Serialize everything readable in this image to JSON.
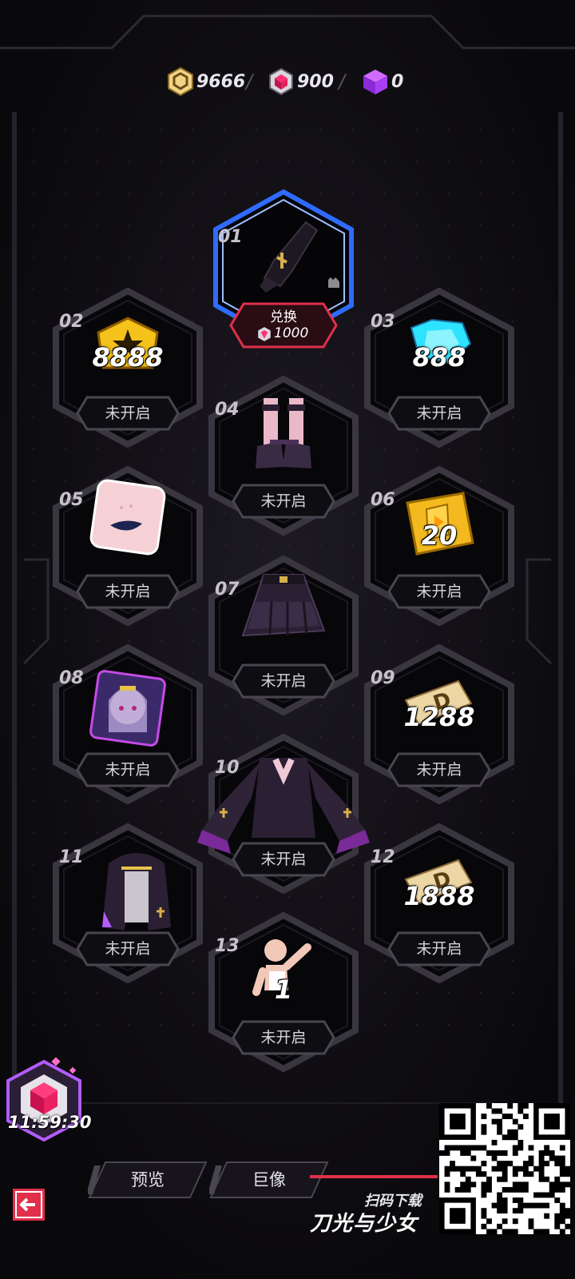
{
  "currencies": [
    {
      "icon": "gold-coin-icon",
      "value": "9666"
    },
    {
      "icon": "red-crystal-icon",
      "value": "900"
    },
    {
      "icon": "purple-cube-icon",
      "value": "0"
    }
  ],
  "featured": {
    "number": "01",
    "item_icon": "black-glove-icon",
    "exchange_label": "兑换",
    "price": "1000"
  },
  "nodes": [
    {
      "number": "02",
      "reward": "8888",
      "icon": "gold-badge-icon",
      "status": "未开启"
    },
    {
      "number": "03",
      "reward": "888",
      "icon": "blue-diamond-icon",
      "status": "未开启"
    },
    {
      "number": "04",
      "reward": "",
      "icon": "boots-outfit-icon",
      "status": "未开启"
    },
    {
      "number": "05",
      "reward": "",
      "icon": "lips-makeup-icon",
      "status": "未开启"
    },
    {
      "number": "06",
      "reward": "20",
      "icon": "gold-ticket-icon",
      "status": "未开启"
    },
    {
      "number": "07",
      "reward": "",
      "icon": "skirt-outfit-icon",
      "status": "未开启"
    },
    {
      "number": "08",
      "reward": "",
      "icon": "avatar-portrait-icon",
      "status": "未开启"
    },
    {
      "number": "09",
      "reward": "1288",
      "icon": "d-voucher-icon",
      "status": "未开启"
    },
    {
      "number": "10",
      "reward": "",
      "icon": "dress-top-icon",
      "status": "未开启"
    },
    {
      "number": "11",
      "reward": "",
      "icon": "headpiece-veil-icon",
      "status": "未开启"
    },
    {
      "number": "12",
      "reward": "1888",
      "icon": "d-voucher-icon",
      "status": "未开启"
    },
    {
      "number": "13",
      "reward": "1",
      "icon": "action-pose-icon",
      "status": "未开启"
    }
  ],
  "timer": {
    "value": "11:59:30",
    "icon": "crystal-cube-icon"
  },
  "nav": {
    "back_icon": "back-arrow-icon",
    "preview_label": "预览",
    "statue_label": "巨像"
  },
  "promo": {
    "scan_label": "扫码下载",
    "game_title": "刀光与少女",
    "qr_icon": "qr-code-icon"
  },
  "colors": {
    "background": "#0c0a0f",
    "accent_red": "#e0304a",
    "accent_blue": "#3a7bff",
    "gold": "#f5c21b"
  }
}
